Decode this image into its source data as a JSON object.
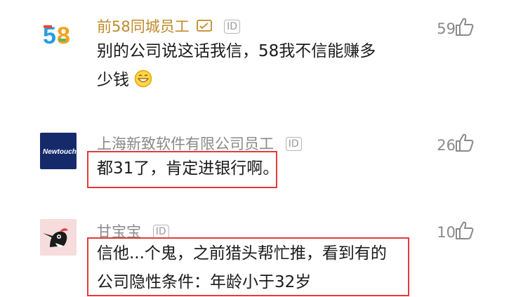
{
  "comments": [
    {
      "username": "前58同城员工",
      "id_badge": "ID",
      "likes": "59",
      "line1": "别的公司说这话我信，58我不信能赚多",
      "line2": "少钱",
      "avatar_text": "58",
      "emoji": "grinning-face-emoji"
    },
    {
      "username": "上海新致软件有限公司员工",
      "id_badge": "ID",
      "likes": "26",
      "line1": "都31了，肯定进银行啊。",
      "avatar_text": "Newtouch"
    },
    {
      "username": "甘宝宝",
      "id_badge": "ID",
      "likes": "10",
      "line1": "信他...个鬼，之前猎头帮忙推，看到有的",
      "line2": "公司隐性条件：年龄小于32岁"
    }
  ],
  "colors": {
    "vip_name": "#c08a2a",
    "plain_name": "#8a8a8a",
    "highlight_box": "#e23b3b",
    "newtouch_bg": "#152a6b"
  }
}
